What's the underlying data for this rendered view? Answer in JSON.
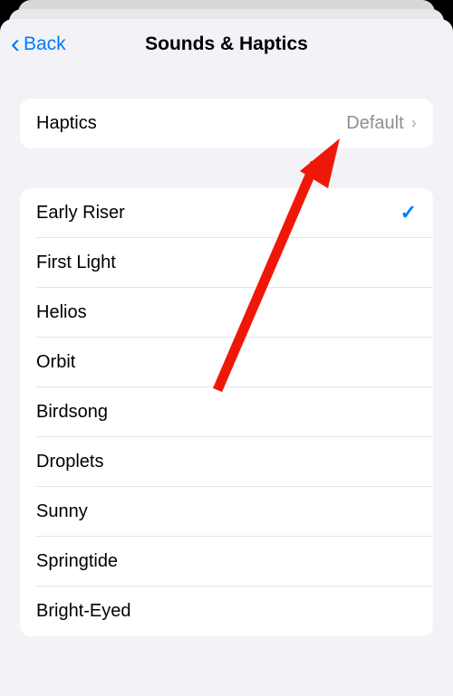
{
  "nav": {
    "back_label": "Back",
    "title": "Sounds & Haptics"
  },
  "haptics": {
    "label": "Haptics",
    "value": "Default"
  },
  "sounds": [
    {
      "label": "Early Riser",
      "selected": true
    },
    {
      "label": "First Light",
      "selected": false
    },
    {
      "label": "Helios",
      "selected": false
    },
    {
      "label": "Orbit",
      "selected": false
    },
    {
      "label": "Birdsong",
      "selected": false
    },
    {
      "label": "Droplets",
      "selected": false
    },
    {
      "label": "Sunny",
      "selected": false
    },
    {
      "label": "Springtide",
      "selected": false
    },
    {
      "label": "Bright-Eyed",
      "selected": false
    }
  ]
}
